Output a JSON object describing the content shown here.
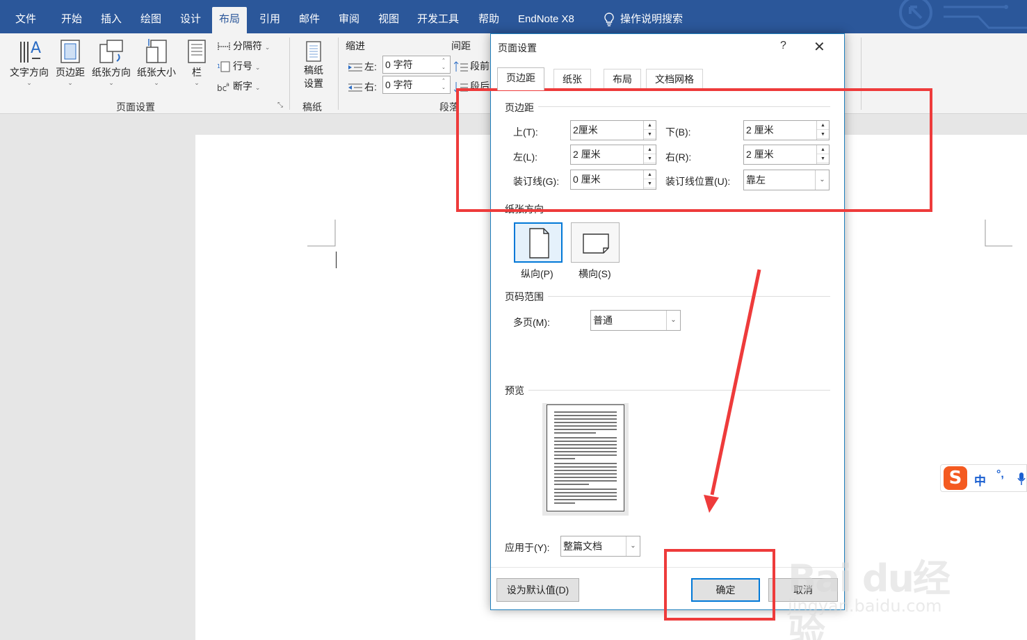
{
  "menubar": {
    "tabs": [
      {
        "label": "文件"
      },
      {
        "label": "开始"
      },
      {
        "label": "插入"
      },
      {
        "label": "绘图"
      },
      {
        "label": "设计"
      },
      {
        "label": "布局"
      },
      {
        "label": "引用"
      },
      {
        "label": "邮件"
      },
      {
        "label": "审阅"
      },
      {
        "label": "视图"
      },
      {
        "label": "开发工具"
      },
      {
        "label": "帮助"
      },
      {
        "label": "EndNote X8"
      }
    ],
    "active_tab": "布局",
    "search_label": "操作说明搜索",
    "bar_color": "#2b579a"
  },
  "ribbon": {
    "text_direction": "文字方向",
    "margins": "页边距",
    "orientation": "纸张方向",
    "size": "纸张大小",
    "columns": "栏",
    "breaks": "分隔符",
    "line_numbers": "行号",
    "hyphenation": "断字",
    "page_setup_group": "页面设置",
    "manuscript_btn_line1": "稿纸",
    "manuscript_btn_line2": "设置",
    "manuscript_group": "稿纸",
    "indent_heading": "缩进",
    "indent_left_label": "左:",
    "indent_left_value": "0 字符",
    "indent_right_label": "右:",
    "indent_right_value": "0 字符",
    "spacing_heading": "间距",
    "spacing_before": "段前",
    "spacing_after": "段后",
    "paragraph_group": "段落"
  },
  "dialog": {
    "title": "页面设置",
    "help": "?",
    "close": "✕",
    "tabs": [
      {
        "label": "页边距"
      },
      {
        "label": "纸张"
      },
      {
        "label": "布局"
      },
      {
        "label": "文档网格"
      }
    ],
    "active_tab": "页边距",
    "margins_section": "页边距",
    "top_label": "上(T):",
    "top_value": "2厘米",
    "bottom_label": "下(B):",
    "bottom_value": "2 厘米",
    "left_label": "左(L):",
    "left_value": "2 厘米",
    "right_label": "右(R):",
    "right_value": "2 厘米",
    "gutter_label": "装订线(G):",
    "gutter_value": "0 厘米",
    "gutter_pos_label": "装订线位置(U):",
    "gutter_pos_value": "靠左",
    "orientation_section": "纸张方向",
    "portrait": "纵向(P)",
    "landscape": "横向(S)",
    "pages_section": "页码范围",
    "multiple_pages_label": "多页(M):",
    "multiple_pages_value": "普通",
    "preview_section": "预览",
    "apply_to_label": "应用于(Y):",
    "apply_to_value": "整篇文档",
    "default_button": "设为默认值(D)",
    "ok_button": "确定",
    "cancel_button": "取消"
  },
  "ime": {
    "logo": "S",
    "mode": "中",
    "punct": "°,"
  },
  "watermark": {
    "line1": "Bai du经验",
    "line2": "jingyan.baidu.com"
  },
  "colors": {
    "accent": "#2b579a",
    "annotation": "#ee3b3b",
    "dialog_border": "#1e7fbd"
  }
}
